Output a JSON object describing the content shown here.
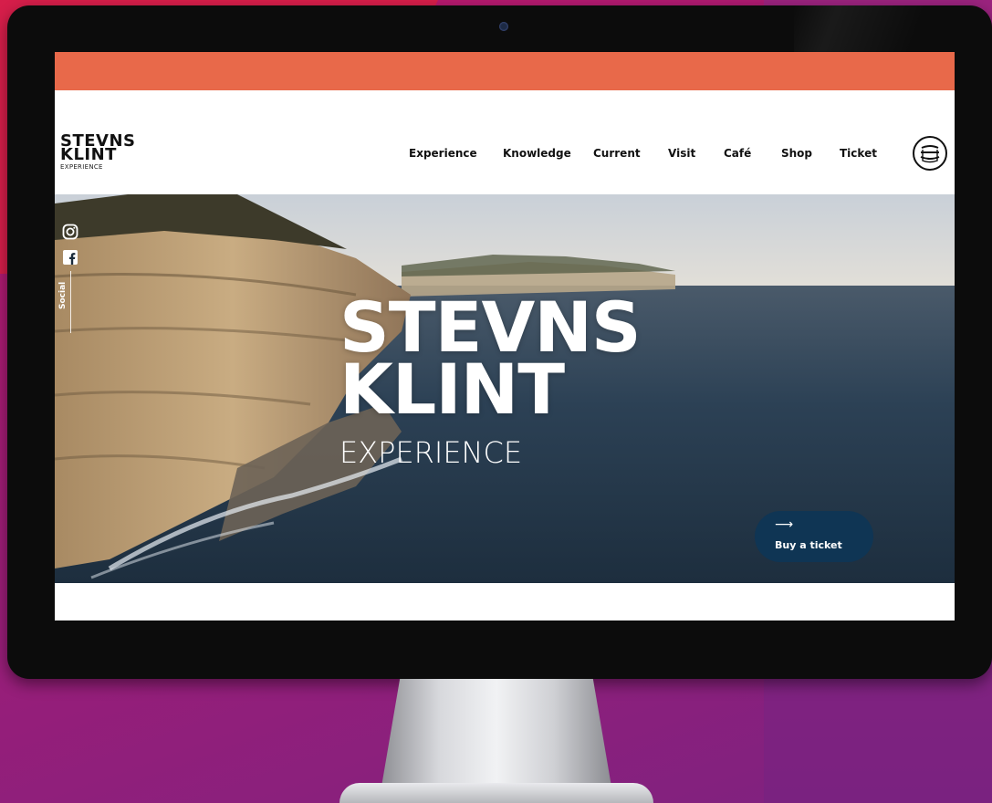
{
  "colors": {
    "top_bar": "#e8694a",
    "cta_background": "#0f3554",
    "backdrop": "#a21c76"
  },
  "logo": {
    "line1": "STEVNS",
    "line2": "KLINT",
    "line3": "EXPERIENCE"
  },
  "nav": {
    "items": [
      {
        "label": "Experience"
      },
      {
        "label": "Knowledge"
      },
      {
        "label": "Current"
      },
      {
        "label": "Visit"
      },
      {
        "label": "Café"
      },
      {
        "label": "Shop"
      },
      {
        "label": "Ticket"
      }
    ],
    "menu_icon": "menu-circle-icon"
  },
  "social": {
    "label": "Social",
    "icons": [
      "instagram-icon",
      "facebook-icon"
    ]
  },
  "hero": {
    "title_line1": "STEVNS",
    "title_line2": "KLINT",
    "subtitle": "EXPERIENCE"
  },
  "cta": {
    "arrow": "⟶",
    "label": "Buy a ticket"
  }
}
